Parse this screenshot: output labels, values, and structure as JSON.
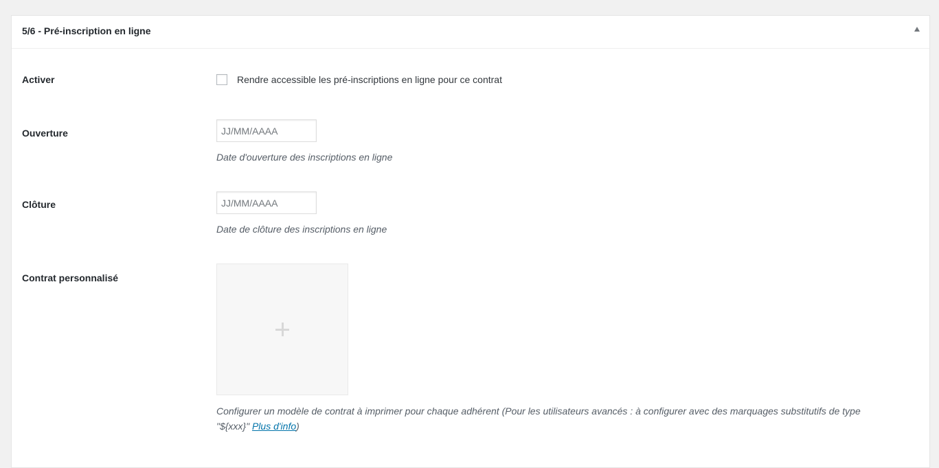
{
  "panel": {
    "title": "5/6 - Pré-inscription en ligne"
  },
  "activate": {
    "label": "Activer",
    "checkbox_label": "Rendre accessible les pré-inscriptions en ligne pour ce contrat",
    "checked": false
  },
  "opening": {
    "label": "Ouverture",
    "placeholder": "JJ/MM/AAAA",
    "value": "",
    "description": "Date d'ouverture des inscriptions en ligne"
  },
  "closing": {
    "label": "Clôture",
    "placeholder": "JJ/MM/AAAA",
    "value": "",
    "description": "Date de clôture des inscriptions en ligne"
  },
  "custom_contract": {
    "label": "Contrat personnalisé",
    "description_before": "Configurer un modèle de contrat à imprimer pour chaque adhérent (Pour les utilisateurs avancés : à configurer avec des marquages substitutifs de type \"${xxx}\" ",
    "link_text": "Plus d'info",
    "description_after": ")"
  },
  "colors": {
    "background": "#f1f1f1",
    "panel": "#ffffff",
    "link": "#0073aa",
    "upload_box": "#f7f7f7"
  },
  "icons": {
    "toggle": "triangle-up-icon",
    "upload": "plus-icon"
  }
}
